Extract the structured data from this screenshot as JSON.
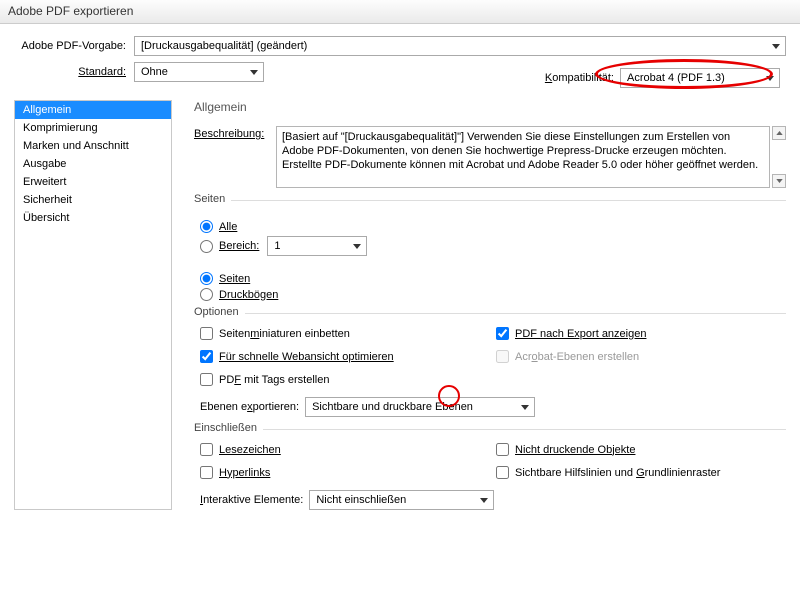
{
  "title": "Adobe PDF exportieren",
  "presetLabel": "Adobe PDF-Vorgabe:",
  "presetValue": "[Druckausgabequalität] (geändert)",
  "standardLabel": "Standard:",
  "standardValue": "Ohne",
  "compatLabel": "Kompatibilität:",
  "compatValue": "Acrobat 4 (PDF 1.3)",
  "sidebar": [
    "Allgemein",
    "Komprimierung",
    "Marken und Anschnitt",
    "Ausgabe",
    "Erweitert",
    "Sicherheit",
    "Übersicht"
  ],
  "panelTitle": "Allgemein",
  "descLabel": "Beschreibung:",
  "descText": "[Basiert auf \"[Druckausgabequalität]\"] Verwenden Sie diese Einstellungen zum Erstellen von Adobe PDF-Dokumenten, von denen Sie hochwertige Prepress-Drucke erzeugen möchten. Erstellte PDF-Dokumente können mit Acrobat und Adobe Reader 5.0 oder höher geöffnet werden.",
  "pages": {
    "group": "Seiten",
    "all": "Alle",
    "range": "Bereich:",
    "rangeValue": "1",
    "pagesRadio": "Seiten",
    "spreads": "Druckbögen"
  },
  "options": {
    "group": "Optionen",
    "thumbs": "Seitenminiaturen einbetten",
    "fastweb": "Für schnelle Webansicht optimieren",
    "tagged": "PDF mit Tags erstellen",
    "viewAfter": "PDF nach Export anzeigen",
    "acrobatLayers": "Acrobat-Ebenen erstellen",
    "exportLayersLabel": "Ebenen exportieren:",
    "exportLayersValue": "Sichtbare und druckbare Ebenen"
  },
  "include": {
    "group": "Einschließen",
    "bookmarks": "Lesezeichen",
    "hyperlinks": "Hyperlinks",
    "nonprint": "Nicht druckende Objekte",
    "guides": "Sichtbare Hilfslinien und Grundlinienraster",
    "interactiveLabel": "Interaktive Elemente:",
    "interactiveValue": "Nicht einschließen"
  }
}
